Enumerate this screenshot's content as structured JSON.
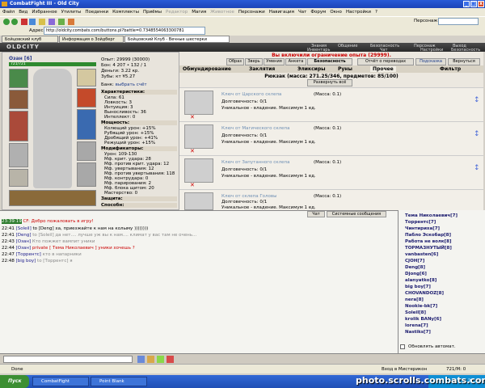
{
  "window": {
    "title": "CombatFight III - Old City"
  },
  "menu": [
    "Файл",
    "Вид",
    "Избранное",
    "Утилиты",
    "Поединки",
    "Комплекты",
    "Приёмы",
    "Редактор",
    "Магия",
    "Животное",
    "Персонажи",
    "Навигация",
    "Чат",
    "Форум",
    "Окно",
    "Настройки",
    "?"
  ],
  "toolbar": {
    "person_label": "Персонаж:"
  },
  "address": {
    "label": "Адрес:",
    "url": "http://oldcity.combats.com/buttons.pl?battle=0.7348554063300781"
  },
  "tabs": [
    "Бойцовский клуб",
    "Информация о Зойдберг",
    "Бойцовский Клуб - Вечные шестерки"
  ],
  "game_header": {
    "logo": "OLDCITY",
    "links": [
      "Знания",
      "Общение",
      "Безопасность",
      "Персонаж",
      "Выход",
      "Инвентарь",
      "Чат",
      "Настройки",
      "Безопасность"
    ]
  },
  "character": {
    "name": "Озан",
    "level": "[6]",
    "hp": "721/721",
    "stats": {
      "exp": "Опыт: 29999 (30000)",
      "bonus": "Бон: 4 207 • 132 / 1",
      "money": "Деньги: 3.22 кр.",
      "teeth": "Зубы: кт ¥5.27"
    },
    "bank_label": "Банк:",
    "bank_link": "выбрать счёт",
    "characteristics_header": "Характеристики:",
    "characteristics": [
      "Сила: 61",
      "Ловкость: 3",
      "Интуиция: 3",
      "Выносливость: 36",
      "Интеллект: 0"
    ],
    "mastery_header": "Мощность:",
    "mastery": [
      "Колющий урон: +15%",
      "Рубящий урон: +15%",
      "Дробящий урон: +41%",
      "Режущий урон: +15%"
    ],
    "modifiers_header": "Модификаторы:",
    "modifiers": [
      "Урон: 109-130",
      "Мф. крит. удара: 28",
      "Мф. против крит. удара: 12",
      "Мф. увертывания: 12",
      "Мф. против увертывания: 118",
      "Мф. контрудара: 0",
      "Мф. парирования: 2",
      "Мф. блока щитом: 20",
      "Мастерство: 0"
    ],
    "protection_header": "Защита:",
    "abilities_header": "Способн:"
  },
  "inventory": {
    "warning": "Вы включили ограничение опыта (29999).",
    "top_buttons": [
      "Образ",
      "Зверь",
      "Умения",
      "Анкета",
      "Безопасность",
      "Отчёт о переводах",
      "Подсказка",
      "Вернуться"
    ],
    "categories": [
      "Обмундирование",
      "Заклятия",
      "Эликсиры",
      "Руны",
      "Прочее",
      "Фильтр"
    ],
    "backpack": "Рюкзак (масса: 271.25/346, предметов: 85/100)",
    "expand_all": "Развернуть всё",
    "items": [
      {
        "name": "Ключ от Царского склепа",
        "mass": "(Масса: 0.1)",
        "durability": "Долговечность: 0/1",
        "unique": "Уникальное - владение. Максимум 1 ед."
      },
      {
        "name": "Ключ от Магического склепа",
        "mass": "(Масса: 0.1)",
        "durability": "Долговечность: 0/1",
        "unique": "Уникальное - владение. Максимум 1 ед."
      },
      {
        "name": "Ключ от Запутанного склепа",
        "mass": "(Масса: 0.1)",
        "durability": "Долговечность: 0/1",
        "unique": "Уникальное - владение. Максимум 1 ед."
      },
      {
        "name": "Ключ от склепа Головы",
        "mass": "(Масса: 0.1)",
        "durability": "Долговечность: 0/1",
        "unique": "Уникальное - владение. Максимум 1 ед."
      }
    ]
  },
  "chat": {
    "tabs": [
      "Чат",
      "Системные сообщения"
    ],
    "lines": [
      {
        "time": "23:39:19",
        "name": "",
        "text": "CF: Добро пожаловать в игру!"
      },
      {
        "time": "22:41",
        "name": "[Soleil]",
        "text": "to [Deng] ха, приезжайте к нам на колыму ))))))))"
      },
      {
        "time": "22:41",
        "name": "[Deng]",
        "text": "to [Soleil] да нет.... лучше уж вы к нам.... климат у вас там не очень..."
      },
      {
        "time": "22:43",
        "name": "[Озан]",
        "text": "Кто пожжет вампит уники"
      },
      {
        "time": "22:44",
        "name": "[Озан]",
        "text": "private [ Тема Николаевич ] уники хочешь ?"
      },
      {
        "time": "22:47",
        "name": "[Торрентс]",
        "text": "кто в напарники"
      },
      {
        "time": "22:48",
        "name": "[big boy]",
        "text": "to [Торрентс] я"
      }
    ]
  },
  "userlist": {
    "users": [
      "Тема Николаевич[7]",
      "Торрентс[7]",
      "Чинтириха[7]",
      "Пабло Эскобар[8]",
      "Работа не волк[8]",
      "ТОРМАЗНУТЫЙ[8]",
      "vanbasten[6]",
      "CJOH[7]",
      "Deng[8]",
      "Djong[6]",
      "alanyatko[8]",
      "big boy[7]",
      "CHOVANDOZ[8]",
      "nera[8]",
      "Nookie-bk[7]",
      "Soleil[8]",
      "krolik BANy[6]",
      "lorena[7]",
      "Nastiks[7]"
    ],
    "auto_refresh": "Обновлять автомат."
  },
  "statusbar": {
    "left": "Done",
    "right1": "Вход в Мистерикон",
    "right2": "721/М: 0"
  },
  "taskbar": {
    "start": "Пуск",
    "items": [
      "CombatFight",
      "Point Blank"
    ],
    "time": "22:49"
  },
  "watermark": "photo.scrolls.combats.com"
}
